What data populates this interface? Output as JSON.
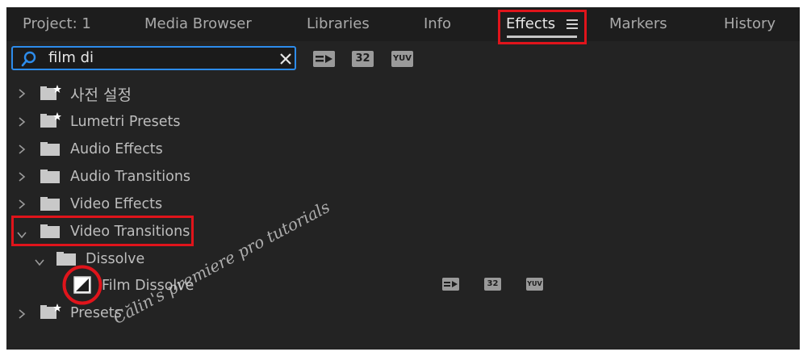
{
  "tabs": [
    {
      "label": "Project: 1"
    },
    {
      "label": "Media Browser"
    },
    {
      "label": "Libraries"
    },
    {
      "label": "Info"
    },
    {
      "label": "Effects"
    },
    {
      "label": "Markers"
    },
    {
      "label": "History"
    }
  ],
  "active_tab": "Effects",
  "search": {
    "value": "film di"
  },
  "filter_buttons": {
    "accelerated": "",
    "bit32": "32",
    "yuv": "YUV"
  },
  "tree": [
    {
      "label": "사전 설정",
      "type": "preset-folder",
      "expanded": false
    },
    {
      "label": "Lumetri Presets",
      "type": "preset-folder",
      "expanded": false
    },
    {
      "label": "Audio Effects",
      "type": "folder",
      "expanded": false
    },
    {
      "label": "Audio Transitions",
      "type": "folder",
      "expanded": false
    },
    {
      "label": "Video Effects",
      "type": "folder",
      "expanded": false
    },
    {
      "label": "Video Transitions",
      "type": "folder",
      "expanded": true
    },
    {
      "label": "Dissolve",
      "type": "folder",
      "expanded": true
    },
    {
      "label": "Film Dissolve",
      "type": "effect"
    },
    {
      "label": "Presets",
      "type": "preset-folder",
      "expanded": false
    }
  ],
  "item_badges": {
    "bit32": "32",
    "yuv": "YUV"
  },
  "watermark": "Călin's premiere pro tutorials",
  "colors": {
    "highlight": "#e0141b",
    "search_border": "#2d8ceb",
    "panel_bg": "#232323"
  }
}
